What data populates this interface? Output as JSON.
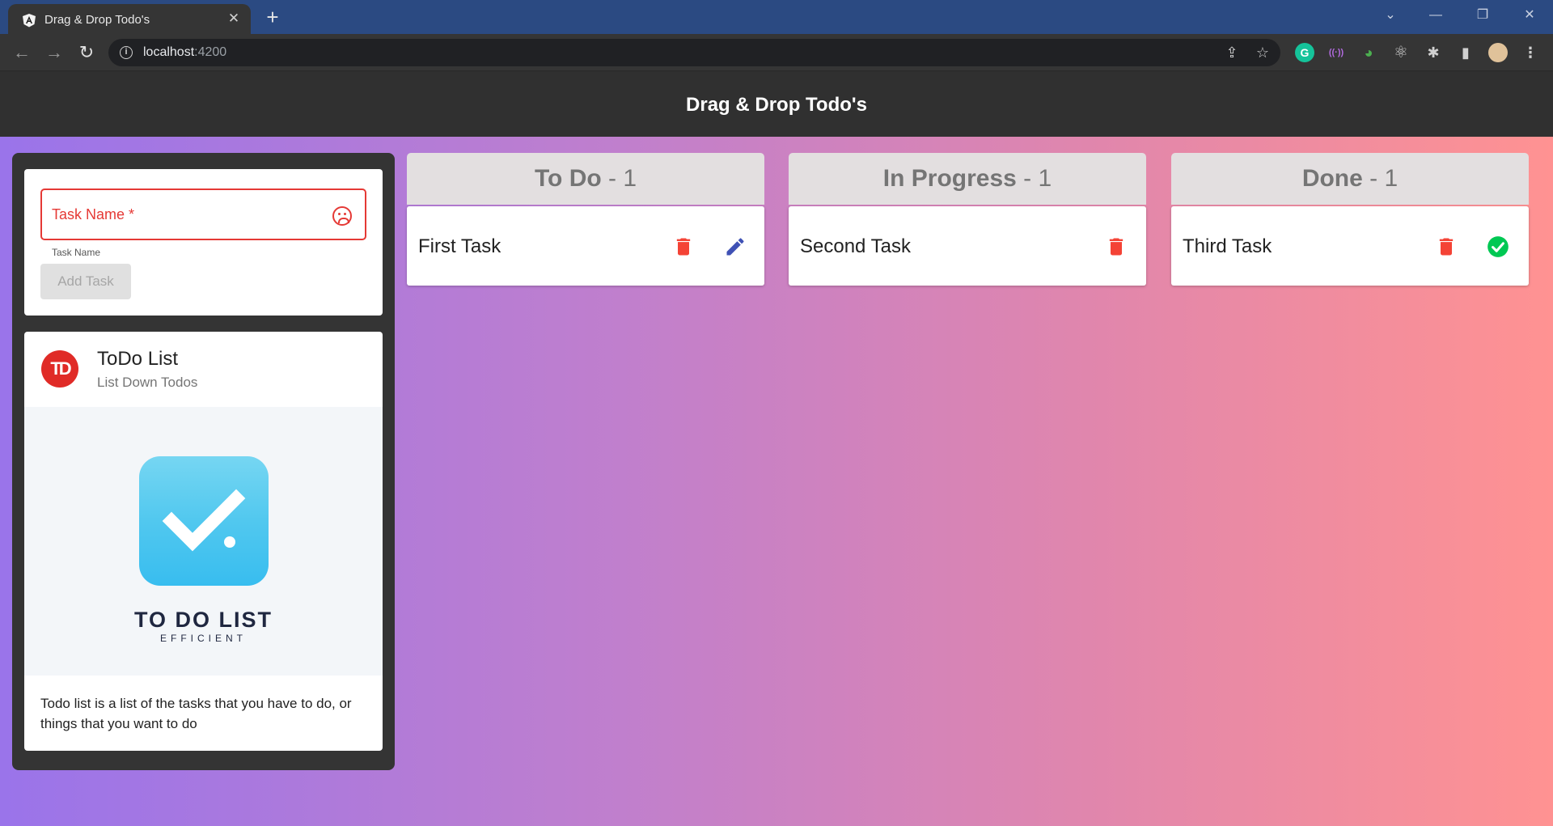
{
  "browser": {
    "tab_title": "Drag & Drop Todo's",
    "tab_close": "✕",
    "new_tab": "+",
    "url_host": "localhost",
    "url_port": ":4200",
    "info": "i",
    "window_controls": {
      "menu": "⌄",
      "minimize": "—",
      "restore": "❐",
      "close": "✕"
    },
    "nav": {
      "back": "←",
      "forward": "→",
      "reload": "↻"
    },
    "actions": {
      "share": "⇪",
      "bookmark": "☆",
      "extensions": "✱",
      "sidepanel": "▮",
      "menu": "⋮"
    },
    "extensions": [
      {
        "name": "grammarly-icon",
        "glyph": "G",
        "color": "#15c39a"
      },
      {
        "name": "devtools-icon",
        "glyph": "((·))",
        "color": "#b26be0"
      },
      {
        "name": "colorzilla-icon",
        "glyph": "◕",
        "color": "#4caf50"
      },
      {
        "name": "react-icon",
        "glyph": "⚛",
        "color": "#cfcfcf"
      }
    ]
  },
  "header": {
    "title": "Drag & Drop Todo's"
  },
  "form": {
    "label": "Task Name *",
    "input_value": "",
    "hint": "Task Name",
    "add_button": "Add Task",
    "error_color": "#e53935"
  },
  "info_card": {
    "avatar_text": "TD",
    "title": "ToDo List",
    "subtitle": "List Down Todos",
    "image_title": "TO DO LIST",
    "image_subtitle": "EFFICIENT",
    "description": "Todo list is a list of the tasks that you have to do, or things that you want to do"
  },
  "columns": [
    {
      "name": "To Do",
      "count": " - 1",
      "tasks": [
        {
          "title": "First Task",
          "actions": [
            "delete",
            "edit"
          ]
        }
      ]
    },
    {
      "name": "In Progress",
      "count": " - 1",
      "tasks": [
        {
          "title": "Second Task",
          "actions": [
            "delete"
          ]
        }
      ]
    },
    {
      "name": "Done",
      "count": " - 1",
      "tasks": [
        {
          "title": "Third Task",
          "actions": [
            "delete",
            "complete"
          ]
        }
      ]
    }
  ],
  "colors": {
    "delete": "#f44336",
    "edit": "#3f51b5",
    "complete": "#00c853",
    "header_bg": "#303030",
    "gradient_start": "#9a74ea",
    "gradient_end": "#ff9292"
  }
}
